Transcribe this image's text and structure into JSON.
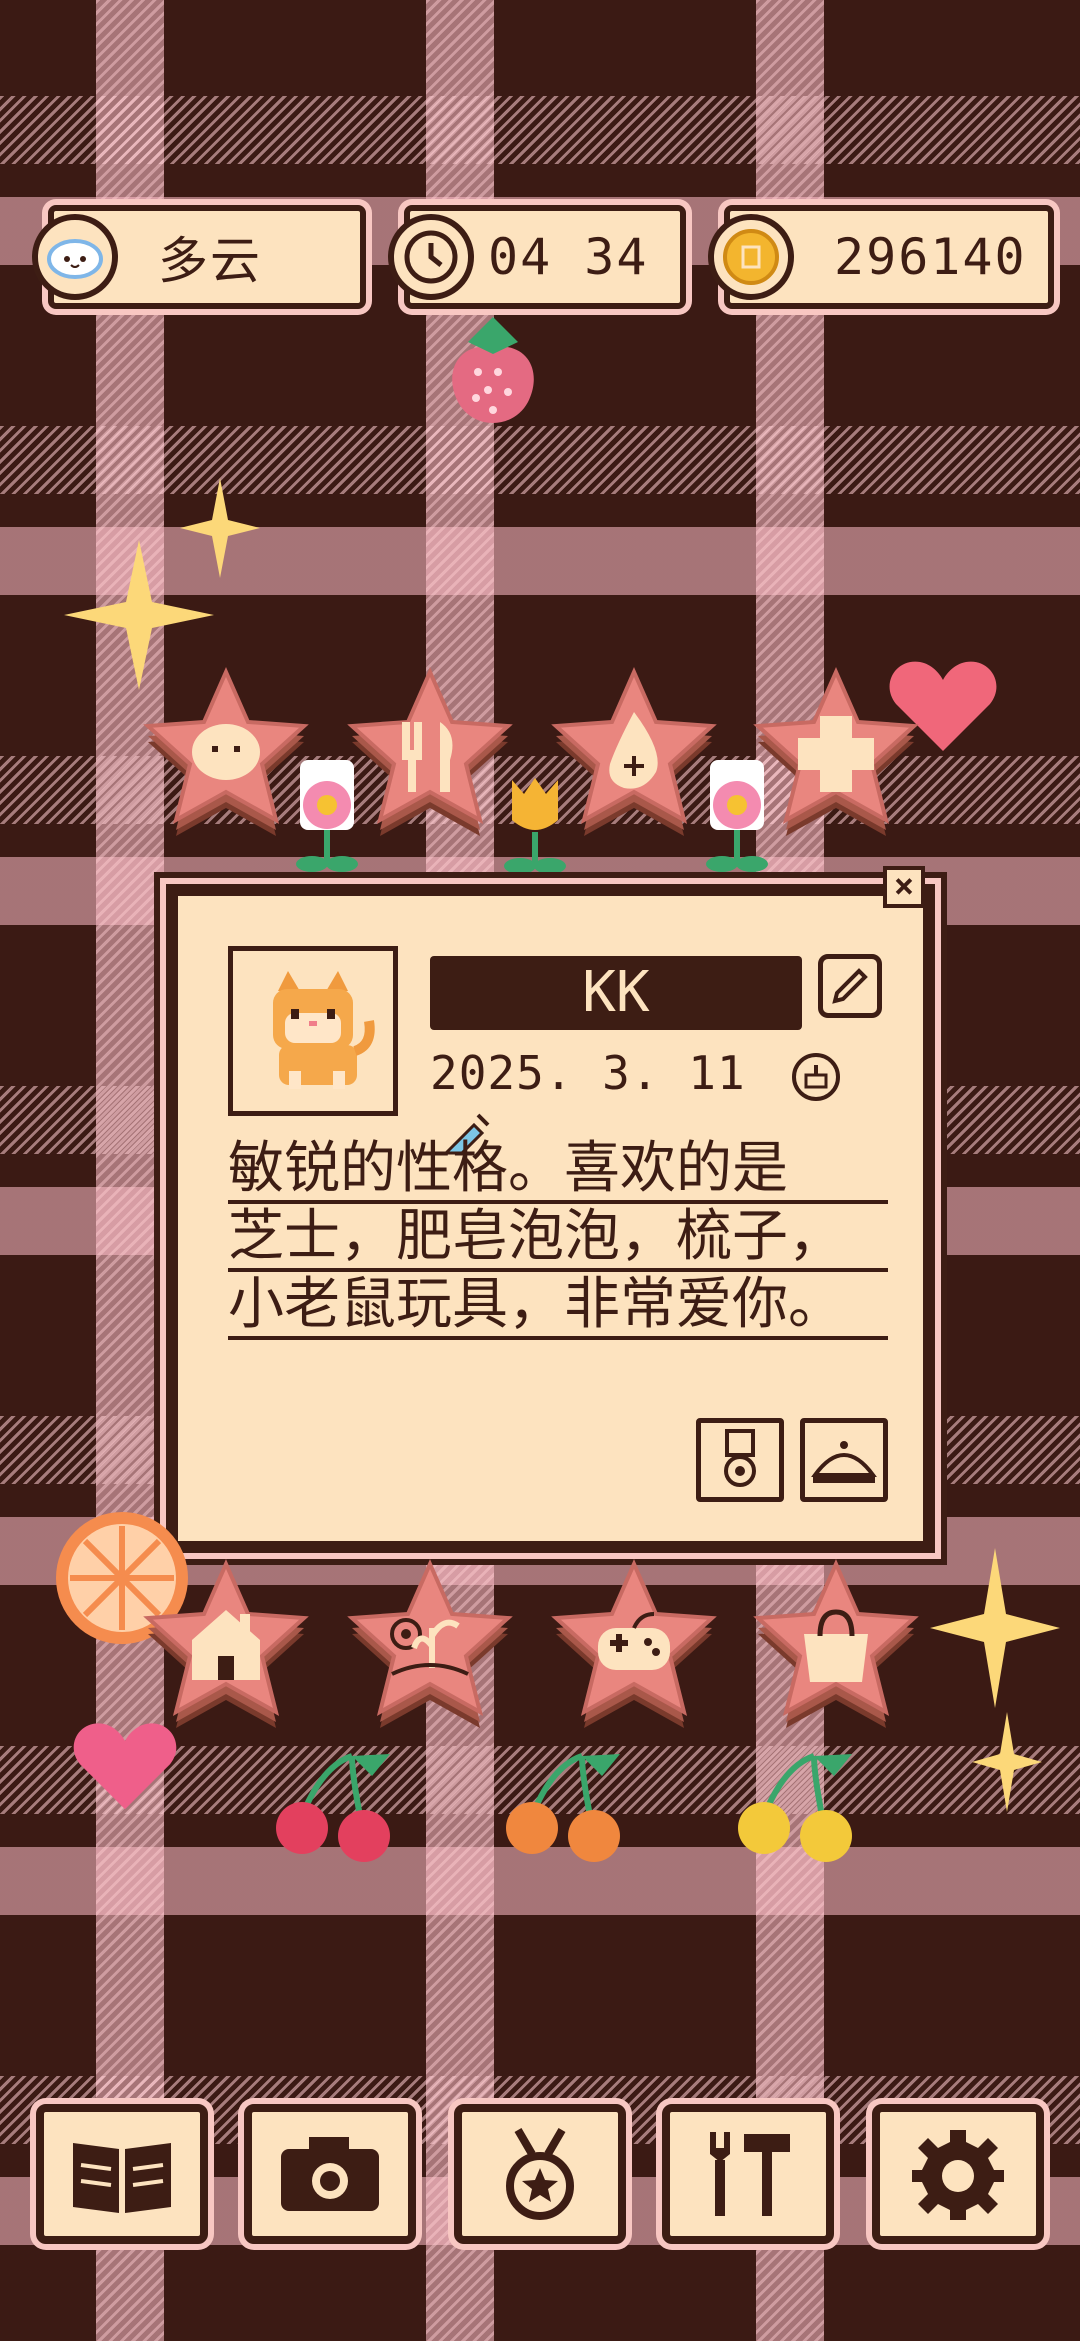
{
  "status_bar": {
    "weather": {
      "label": "多云",
      "icon": "cloud-face-icon"
    },
    "clock": {
      "time": "04 34",
      "icon": "clock-icon"
    },
    "coins": {
      "value": "296140",
      "icon": "coin-icon"
    }
  },
  "top_menu": [
    {
      "name": "bread-star-button",
      "icon": "bread-icon"
    },
    {
      "name": "food-star-button",
      "icon": "fork-knife-icon"
    },
    {
      "name": "water-star-button",
      "icon": "water-drop-icon"
    },
    {
      "name": "health-star-button",
      "icon": "plus-cross-icon"
    }
  ],
  "pet_card": {
    "name": "KK",
    "birthday": "2025. 3. 11",
    "description_lines": [
      "敏锐的性格。喜欢的是",
      "芝士，肥皂泡泡，梳子，",
      "小老鼠玩具，非常爱你。"
    ]
  },
  "bottom_menu": [
    {
      "name": "home-star-button",
      "icon": "house-icon"
    },
    {
      "name": "garden-star-button",
      "icon": "plant-icon"
    },
    {
      "name": "game-star-button",
      "icon": "gamepad-icon"
    },
    {
      "name": "shop-star-button",
      "icon": "bag-icon"
    }
  ],
  "nav_bar": [
    {
      "name": "nav-book",
      "icon": "book-icon"
    },
    {
      "name": "nav-camera",
      "icon": "camera-icon"
    },
    {
      "name": "nav-medal",
      "icon": "medal-icon"
    },
    {
      "name": "nav-tools",
      "icon": "tools-icon"
    },
    {
      "name": "nav-settings",
      "icon": "gear-icon"
    }
  ],
  "colors": {
    "dark": "#3d1d14",
    "cream": "#fde3bf",
    "pink": "#f8c7c2",
    "star_pink": "#e9867f",
    "star_base": "#a9584a"
  }
}
